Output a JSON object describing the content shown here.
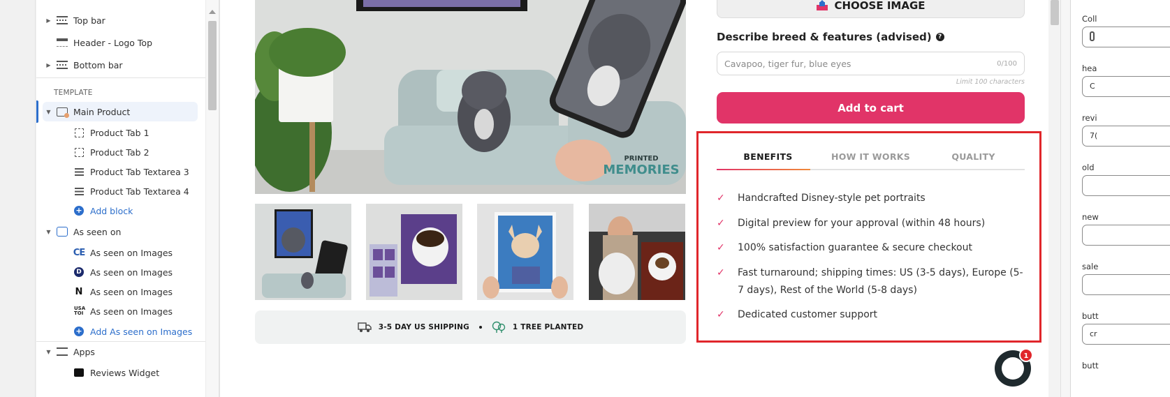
{
  "sidebar": {
    "sections": {
      "top_bar": "Top bar",
      "header": "Header - Logo Top",
      "bottom_bar": "Bottom bar",
      "template_label": "TEMPLATE",
      "main_product": "Main Product",
      "product_tab_1": "Product Tab 1",
      "product_tab_2": "Product Tab 2",
      "product_tab_3": "Product Tab Textarea 3",
      "product_tab_4": "Product Tab Textarea 4",
      "add_block": "Add block",
      "as_seen_on": "As seen on",
      "as_seen_items": [
        "As seen on Images",
        "As seen on Images",
        "As seen on Images",
        "As seen on Images"
      ],
      "add_as_seen": "Add As seen on Images",
      "apps": "Apps",
      "reviews_widget": "Reviews Widget"
    },
    "logo_glyphs": [
      "CE",
      "D",
      "N",
      "USA TOI"
    ]
  },
  "preview": {
    "hero_watermark_top": "PRINTED",
    "hero_watermark_bottom": "MEMORIES",
    "choose_image": "CHOOSE IMAGE",
    "describe_label": "Describe breed & features (advised)",
    "describe_placeholder": "Cavapoo, tiger fur, blue eyes",
    "describe_counter": "0/100",
    "limit_text": "Limit 100 characters",
    "add_to_cart": "Add to cart",
    "shipping": "3-5 DAY US SHIPPING",
    "tree": "1 TREE PLANTED",
    "tabs": [
      "BENEFITS",
      "HOW IT WORKS",
      "QUALITY"
    ],
    "active_tab": "BENEFITS",
    "benefits": [
      "Handcrafted Disney-style pet portraits",
      "Digital preview for your approval (within 48 hours)",
      "100% satisfaction guarantee & secure checkout",
      "Fast turnaround; shipping times: US (3-5 days), Europe (5-7 days), Rest of the World (5-8 days)",
      "Dedicated customer support"
    ],
    "chat_badge": "1"
  },
  "settings": {
    "labels": [
      "Coll",
      "hea",
      "revi",
      "old",
      "new",
      "sale",
      "butt",
      "butt"
    ],
    "values": [
      "",
      "C",
      "7(",
      "",
      "",
      "",
      "cr",
      ""
    ]
  },
  "colors": {
    "accent_pink": "#e13468",
    "highlight_red": "#e0262b",
    "editor_blue": "#2c6ecb"
  }
}
